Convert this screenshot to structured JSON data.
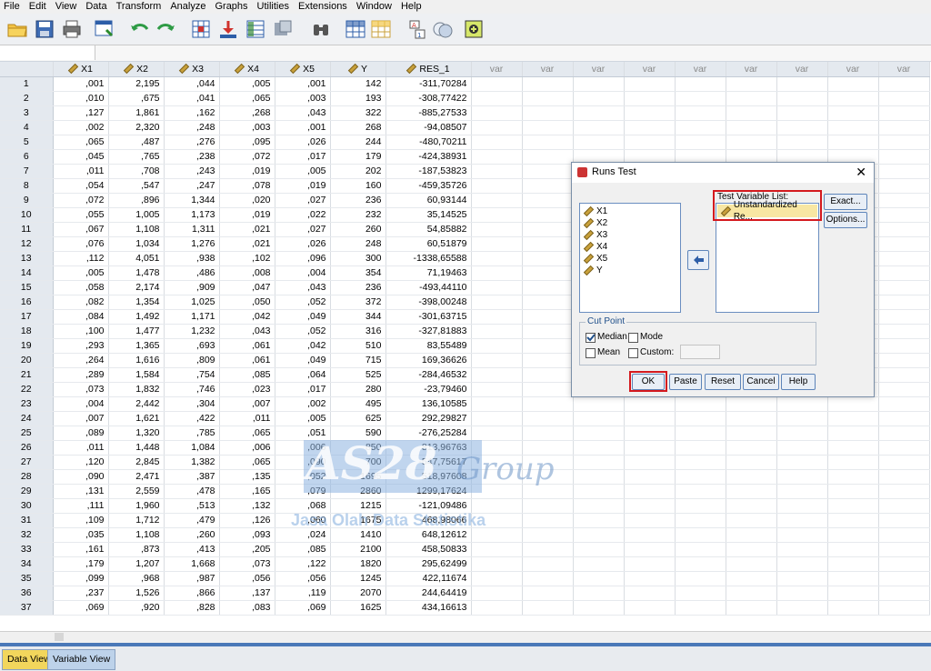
{
  "menu": [
    "File",
    "Edit",
    "View",
    "Data",
    "Transform",
    "Analyze",
    "Graphs",
    "Utilities",
    "Extensions",
    "Window",
    "Help"
  ],
  "toolbar": {
    "icons": [
      "open-folder-icon",
      "save-icon",
      "print-icon",
      "recall-dialog-icon",
      "undo-icon",
      "redo-icon",
      "goto-case-icon",
      "goto-variable-icon",
      "variables-icon",
      "run-descriptives-icon",
      "find-icon",
      "insert-cases-icon",
      "insert-variable-icon",
      "split-file-icon",
      "weight-cases-icon",
      "select-cases-icon",
      "value-labels-icon",
      "use-sets-icon"
    ]
  },
  "columns": [
    "X1",
    "X2",
    "X3",
    "X4",
    "X5",
    "Y",
    "RES_1",
    "var",
    "var",
    "var",
    "var",
    "var",
    "var",
    "var",
    "var",
    "var"
  ],
  "rows": [
    [
      ",001",
      "2,195",
      ",044",
      ",005",
      ",001",
      "142",
      "-311,70284"
    ],
    [
      ",010",
      ",675",
      ",041",
      ",065",
      ",003",
      "193",
      "-308,77422"
    ],
    [
      ",127",
      "1,861",
      ",162",
      ",268",
      ",043",
      "322",
      "-885,27533"
    ],
    [
      ",002",
      "2,320",
      ",248",
      ",003",
      ",001",
      "268",
      "-94,08507"
    ],
    [
      ",065",
      ",487",
      ",276",
      ",095",
      ",026",
      "244",
      "-480,70211"
    ],
    [
      ",045",
      ",765",
      ",238",
      ",072",
      ",017",
      "179",
      "-424,38931"
    ],
    [
      ",011",
      ",708",
      ",243",
      ",019",
      ",005",
      "202",
      "-187,53823"
    ],
    [
      ",054",
      ",547",
      ",247",
      ",078",
      ",019",
      "160",
      "-459,35726"
    ],
    [
      ",072",
      ",896",
      "1,344",
      ",020",
      ",027",
      "236",
      "60,93144"
    ],
    [
      ",055",
      "1,005",
      "1,173",
      ",019",
      ",022",
      "232",
      "35,14525"
    ],
    [
      ",067",
      "1,108",
      "1,311",
      ",021",
      ",027",
      "260",
      "54,85882"
    ],
    [
      ",076",
      "1,034",
      "1,276",
      ",021",
      ",026",
      "248",
      "60,51879"
    ],
    [
      ",112",
      "4,051",
      ",938",
      ",102",
      ",096",
      "300",
      "-1338,65588"
    ],
    [
      ",005",
      "1,478",
      ",486",
      ",008",
      ",004",
      "354",
      "71,19463"
    ],
    [
      ",058",
      "2,174",
      ",909",
      ",047",
      ",043",
      "236",
      "-493,44110"
    ],
    [
      ",082",
      "1,354",
      "1,025",
      ",050",
      ",052",
      "372",
      "-398,00248"
    ],
    [
      ",084",
      "1,492",
      "1,171",
      ",042",
      ",049",
      "344",
      "-301,63715"
    ],
    [
      ",100",
      "1,477",
      "1,232",
      ",043",
      ",052",
      "316",
      "-327,81883"
    ],
    [
      ",293",
      "1,365",
      ",693",
      ",061",
      ",042",
      "510",
      "83,55489"
    ],
    [
      ",264",
      "1,616",
      ",809",
      ",061",
      ",049",
      "715",
      "169,36626"
    ],
    [
      ",289",
      "1,584",
      ",754",
      ",085",
      ",064",
      "525",
      "-284,46532"
    ],
    [
      ",073",
      "1,832",
      ",746",
      ",023",
      ",017",
      "280",
      "-23,79460"
    ],
    [
      ",004",
      "2,442",
      ",304",
      ",007",
      ",002",
      "495",
      "136,10585"
    ],
    [
      ",007",
      "1,621",
      ",422",
      ",011",
      ",005",
      "625",
      "292,29827"
    ],
    [
      ",089",
      "1,320",
      ",785",
      ",065",
      ",051",
      "590",
      "-276,25284"
    ],
    [
      ",011",
      "1,448",
      "1,084",
      ",006",
      ",006",
      "850",
      "813,96763"
    ],
    [
      ",120",
      "2,845",
      "1,382",
      ",065",
      ",090",
      "700",
      "-547,75617"
    ],
    [
      ",090",
      "2,471",
      ",387",
      ",135",
      ",052",
      "1695",
      "518,97608"
    ],
    [
      ",131",
      "2,559",
      ",478",
      ",165",
      ",079",
      "2860",
      "1299,17624"
    ],
    [
      ",111",
      "1,960",
      ",513",
      ",132",
      ",068",
      "1215",
      "-121,09486"
    ],
    [
      ",109",
      "1,712",
      ",479",
      ",126",
      ",060",
      "1675",
      "468,98066"
    ],
    [
      ",035",
      "1,108",
      ",260",
      ",093",
      ",024",
      "1410",
      "648,12612"
    ],
    [
      ",161",
      ",873",
      ",413",
      ",205",
      ",085",
      "2100",
      "458,50833"
    ],
    [
      ",179",
      "1,207",
      "1,668",
      ",073",
      ",122",
      "1820",
      "295,62499"
    ],
    [
      ",099",
      ",968",
      ",987",
      ",056",
      ",056",
      "1245",
      "422,11674"
    ],
    [
      ",237",
      "1,526",
      ",866",
      ",137",
      ",119",
      "2070",
      "244,64419"
    ],
    [
      ",069",
      ",920",
      ",828",
      ",083",
      ",069",
      "1625",
      "434,16613"
    ]
  ],
  "tabs": {
    "data_view": "Data View",
    "variable_view": "Variable View"
  },
  "watermark": {
    "brand": "AS28",
    "group": "Group",
    "tagline": "Jasa Olah Data Statistika"
  },
  "dialog": {
    "title": "Runs Test",
    "close": "✕",
    "variables": [
      "X1",
      "X2",
      "X3",
      "X4",
      "X5",
      "Y"
    ],
    "test_variable_label": "Test Variable List:",
    "test_variables": [
      "Unstandardized Re..."
    ],
    "exact_label": "Exact...",
    "options_label": "Options...",
    "cut_point_label": "Cut Point",
    "median_label": "Median",
    "mode_label": "Mode",
    "mean_label": "Mean",
    "custom_label": "Custom:",
    "median_checked": true,
    "ok_label": "OK",
    "paste_label": "Paste",
    "reset_label": "Reset",
    "cancel_label": "Cancel",
    "help_label": "Help"
  },
  "colors": {
    "accent_red": "#d4191e",
    "tab_active": "#f2d65c",
    "header_bg": "#e4e9ef"
  }
}
